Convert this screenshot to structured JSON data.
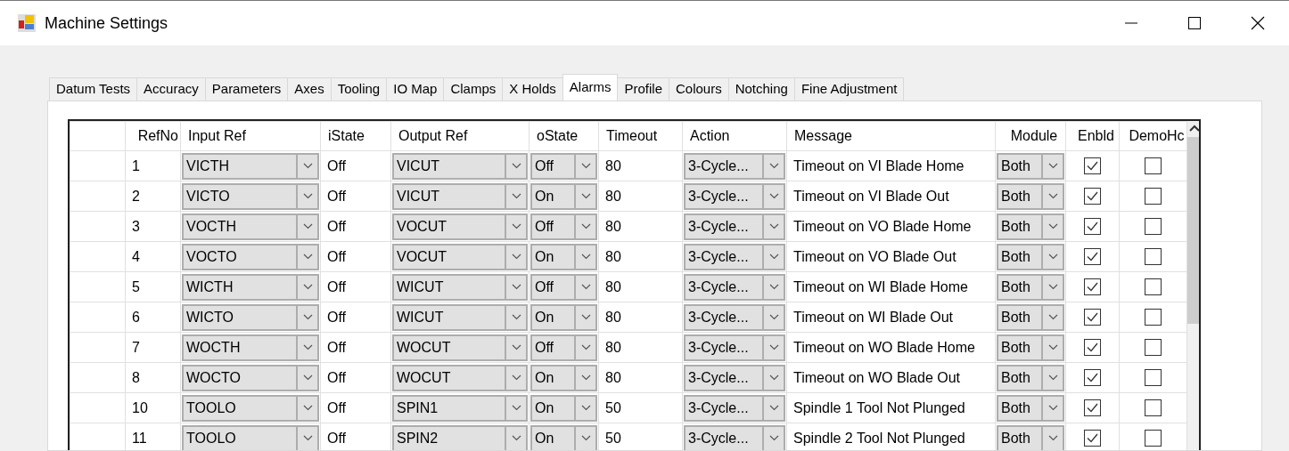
{
  "window": {
    "title": "Machine Settings"
  },
  "tabs": [
    {
      "label": "Datum Tests",
      "selected": false
    },
    {
      "label": "Accuracy",
      "selected": false
    },
    {
      "label": "Parameters",
      "selected": false
    },
    {
      "label": "Axes",
      "selected": false
    },
    {
      "label": "Tooling",
      "selected": false
    },
    {
      "label": "IO Map",
      "selected": false
    },
    {
      "label": "Clamps",
      "selected": false
    },
    {
      "label": "X Holds",
      "selected": false
    },
    {
      "label": "Alarms",
      "selected": true
    },
    {
      "label": "Profile",
      "selected": false
    },
    {
      "label": "Colours",
      "selected": false
    },
    {
      "label": "Notching",
      "selected": false
    },
    {
      "label": "Fine Adjustment",
      "selected": false
    }
  ],
  "table": {
    "columns": [
      "RefNo",
      "Input Ref",
      "iState",
      "Output Ref",
      "oState",
      "Timeout",
      "Action",
      "Message",
      "Module",
      "Enbld",
      "DemoHc"
    ],
    "rows": [
      {
        "ref_no": "1",
        "input_ref": "VICTH",
        "istate": "Off",
        "output_ref": "VICUT",
        "ostate": "Off",
        "timeout": "80",
        "action": "3-Cycle...",
        "message": "Timeout on VI Blade Home",
        "module": "Both",
        "enabled": true,
        "demo": false
      },
      {
        "ref_no": "2",
        "input_ref": "VICTO",
        "istate": "Off",
        "output_ref": "VICUT",
        "ostate": "On",
        "timeout": "80",
        "action": "3-Cycle...",
        "message": "Timeout on VI Blade Out",
        "module": "Both",
        "enabled": true,
        "demo": false
      },
      {
        "ref_no": "3",
        "input_ref": "VOCTH",
        "istate": "Off",
        "output_ref": "VOCUT",
        "ostate": "Off",
        "timeout": "80",
        "action": "3-Cycle...",
        "message": "Timeout on VO Blade Home",
        "module": "Both",
        "enabled": true,
        "demo": false
      },
      {
        "ref_no": "4",
        "input_ref": "VOCTO",
        "istate": "Off",
        "output_ref": "VOCUT",
        "ostate": "On",
        "timeout": "80",
        "action": "3-Cycle...",
        "message": "Timeout on VO Blade Out",
        "module": "Both",
        "enabled": true,
        "demo": false
      },
      {
        "ref_no": "5",
        "input_ref": "WICTH",
        "istate": "Off",
        "output_ref": "WICUT",
        "ostate": "Off",
        "timeout": "80",
        "action": "3-Cycle...",
        "message": "Timeout on WI Blade Home",
        "module": "Both",
        "enabled": true,
        "demo": false
      },
      {
        "ref_no": "6",
        "input_ref": "WICTO",
        "istate": "Off",
        "output_ref": "WICUT",
        "ostate": "On",
        "timeout": "80",
        "action": "3-Cycle...",
        "message": "Timeout on WI Blade Out",
        "module": "Both",
        "enabled": true,
        "demo": false
      },
      {
        "ref_no": "7",
        "input_ref": "WOCTH",
        "istate": "Off",
        "output_ref": "WOCUT",
        "ostate": "Off",
        "timeout": "80",
        "action": "3-Cycle...",
        "message": "Timeout on WO Blade Home",
        "module": "Both",
        "enabled": true,
        "demo": false
      },
      {
        "ref_no": "8",
        "input_ref": "WOCTO",
        "istate": "Off",
        "output_ref": "WOCUT",
        "ostate": "On",
        "timeout": "80",
        "action": "3-Cycle...",
        "message": "Timeout on WO Blade Out",
        "module": "Both",
        "enabled": true,
        "demo": false
      },
      {
        "ref_no": "10",
        "input_ref": "TOOLO",
        "istate": "Off",
        "output_ref": "SPIN1",
        "ostate": "On",
        "timeout": "50",
        "action": "3-Cycle...",
        "message": "Spindle 1 Tool Not Plunged",
        "module": "Both",
        "enabled": true,
        "demo": false
      },
      {
        "ref_no": "11",
        "input_ref": "TOOLO",
        "istate": "Off",
        "output_ref": "SPIN2",
        "ostate": "On",
        "timeout": "50",
        "action": "3-Cycle...",
        "message": "Spindle 2 Tool Not Plunged",
        "module": "Both",
        "enabled": true,
        "demo": false
      }
    ]
  }
}
